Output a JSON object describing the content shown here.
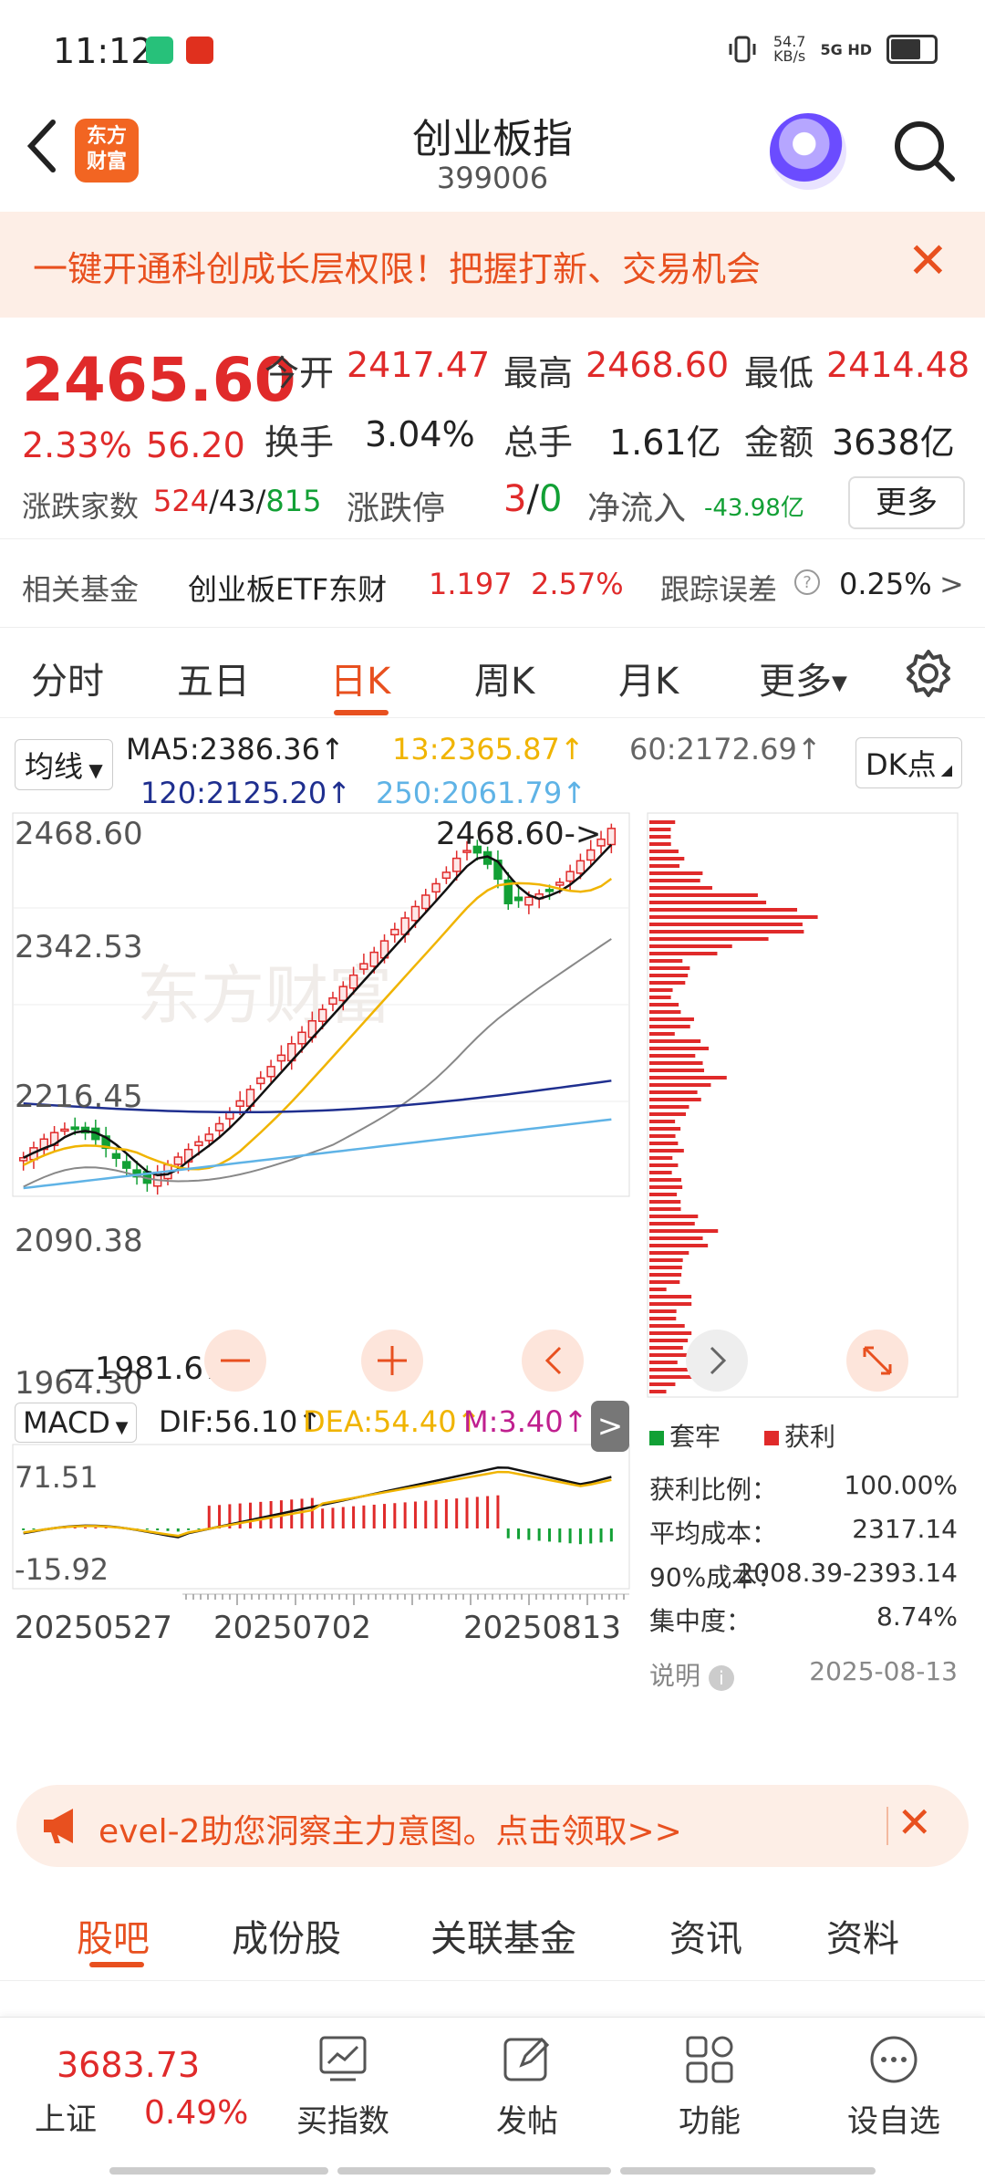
{
  "status": {
    "time": "11:12",
    "net_speed": "54.7",
    "net_unit": "KB/s",
    "network": "5G HD"
  },
  "header": {
    "logo_line1": "东方",
    "logo_line2": "财富",
    "title": "创业板指",
    "code": "399006"
  },
  "banner": {
    "text": "一键开通科创成长层权限！把握打新、交易机会"
  },
  "quote": {
    "price": "2465.60",
    "pct": "2.33%",
    "change": "56.20",
    "open_label": "今开",
    "open": "2417.47",
    "high_label": "最高",
    "high": "2468.60",
    "low_label": "最低",
    "low": "2414.48",
    "turnover_label": "换手",
    "turnover": "3.04%",
    "volume_label": "总手",
    "volume": "1.61亿",
    "amount_label": "金额",
    "amount": "3638亿",
    "breadth_label": "涨跌家数",
    "up": "524",
    "flat": "43",
    "down": "815",
    "limit_label": "涨跌停",
    "limit_up": "3",
    "limit_down": "0",
    "inflow_label": "净流入",
    "inflow": "-43.98亿",
    "more": "更多"
  },
  "fund": {
    "label": "相关基金",
    "name": "创业板ETF东财",
    "price": "1.197",
    "pct": "2.57%",
    "err_label": "跟踪误差",
    "err": "0.25%"
  },
  "tabs": [
    "分时",
    "五日",
    "日K",
    "周K",
    "月K",
    "更多"
  ],
  "active_tab": "日K",
  "ma": {
    "selector": "均线",
    "ma5": "MA5:2386.36↑",
    "ma13": "13:2365.87↑",
    "ma60": "60:2172.69↑",
    "ma120": "120:2125.20↑",
    "ma250": "250:2061.79↑",
    "dk": "DK点"
  },
  "kline": {
    "y_labels": [
      "2468.60",
      "2342.53",
      "2216.45",
      "2090.38",
      "1964.30"
    ],
    "high_callout": "2468.60->",
    "low_callout": "1981.67",
    "watermark": "东方财富"
  },
  "macd": {
    "selector": "MACD",
    "dif": "DIF:56.10↑",
    "dea": "DEA:54.40↑",
    "m": "M:3.40↑",
    "y_top": "71.51",
    "y_bottom": "-15.92"
  },
  "dates": [
    "20250527",
    "20250702",
    "20250813"
  ],
  "chips": {
    "legend_trap": "套牢",
    "legend_profit": "获利",
    "rows": [
      {
        "label": "获利比例：",
        "value": "100.00%"
      },
      {
        "label": "平均成本：",
        "value": "2317.14"
      },
      {
        "label": "90%成本：",
        "value": "2008.39-2393.14"
      },
      {
        "label": "集中度：",
        "value": "8.74%"
      }
    ],
    "note_label": "说明",
    "date": "2025-08-13"
  },
  "promo": {
    "text": "evel-2助您洞察主力意图。点击领取>>"
  },
  "bottom_tabs": [
    "股吧",
    "成份股",
    "关联基金",
    "资讯",
    "资料"
  ],
  "bottom_nav": {
    "index_value": "3683.73",
    "index_name": "上证",
    "index_pct": "0.49%",
    "items": [
      "买指数",
      "发帖",
      "功能",
      "设自选"
    ]
  },
  "colors": {
    "accent": "#e8501f",
    "up": "#e02a2a",
    "down": "#12a035",
    "ma13": "#f0b400",
    "ma120": "#1f2f8f",
    "ma250": "#5fb3e6"
  }
}
